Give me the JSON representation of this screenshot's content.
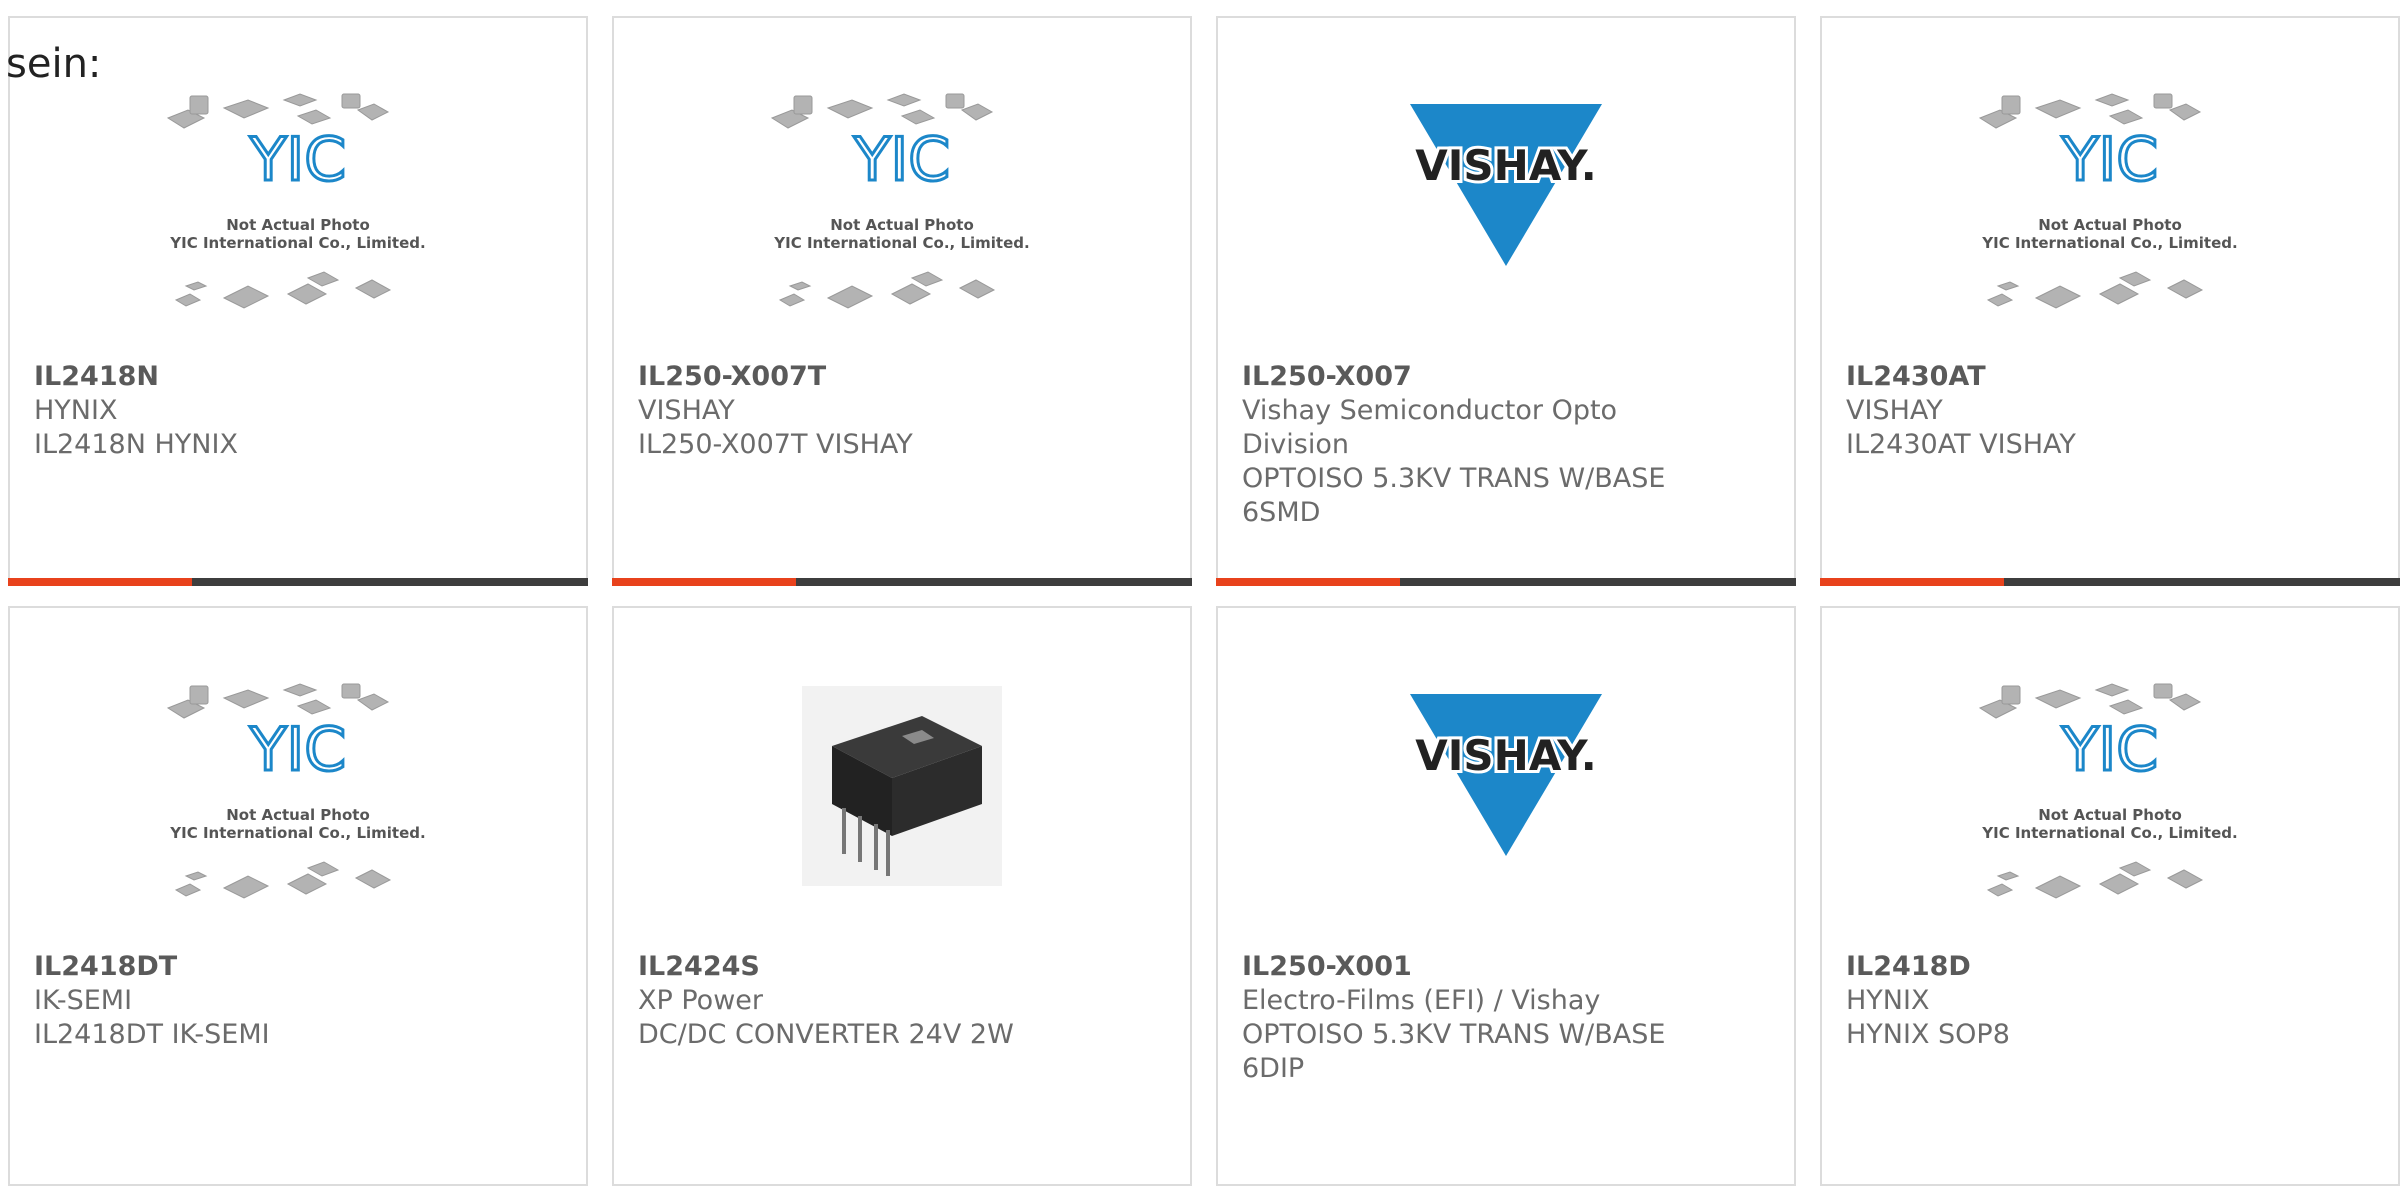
{
  "intro": "sein:",
  "placeholder": {
    "line1": "Not Actual Photo",
    "line2": "YIC International Co., Limited.",
    "logo": "YIC"
  },
  "vishay_logo": "VISHAY.",
  "colors": {
    "accent": "#e8421c",
    "bar": "#3d3d3d",
    "vishay_blue": "#1c87c9",
    "border": "#dcdcdc"
  },
  "products": [
    {
      "image": "yic-placeholder",
      "pn": "IL2418N",
      "mfr": "HYNIX",
      "lines": [
        "IL2418N HYNIX"
      ]
    },
    {
      "image": "yic-placeholder",
      "pn": "IL250-X007T",
      "mfr": "VISHAY",
      "lines": [
        "IL250-X007T VISHAY"
      ]
    },
    {
      "image": "vishay-logo",
      "pn": "IL250-X007",
      "mfr": "Vishay Semiconductor Opto Division",
      "lines": [
        "OPTOISO 5.3KV TRANS W/BASE 6SMD"
      ]
    },
    {
      "image": "yic-placeholder",
      "pn": "IL2430AT",
      "mfr": "VISHAY",
      "lines": [
        "IL2430AT VISHAY"
      ]
    },
    {
      "image": "yic-placeholder",
      "pn": "IL2418DT",
      "mfr": "IK-SEMI",
      "lines": [
        "IL2418DT IK-SEMI"
      ]
    },
    {
      "image": "xp-module",
      "pn": "IL2424S",
      "mfr": "XP Power",
      "lines": [
        "DC/DC CONVERTER 24V 2W"
      ]
    },
    {
      "image": "vishay-logo",
      "pn": "IL250-X001",
      "mfr": "Electro-Films (EFI) / Vishay",
      "lines": [
        "OPTOISO 5.3KV TRANS W/BASE 6DIP"
      ]
    },
    {
      "image": "yic-placeholder",
      "pn": "IL2418D",
      "mfr": "HYNIX",
      "lines": [
        "HYNIX SOP8"
      ]
    }
  ]
}
